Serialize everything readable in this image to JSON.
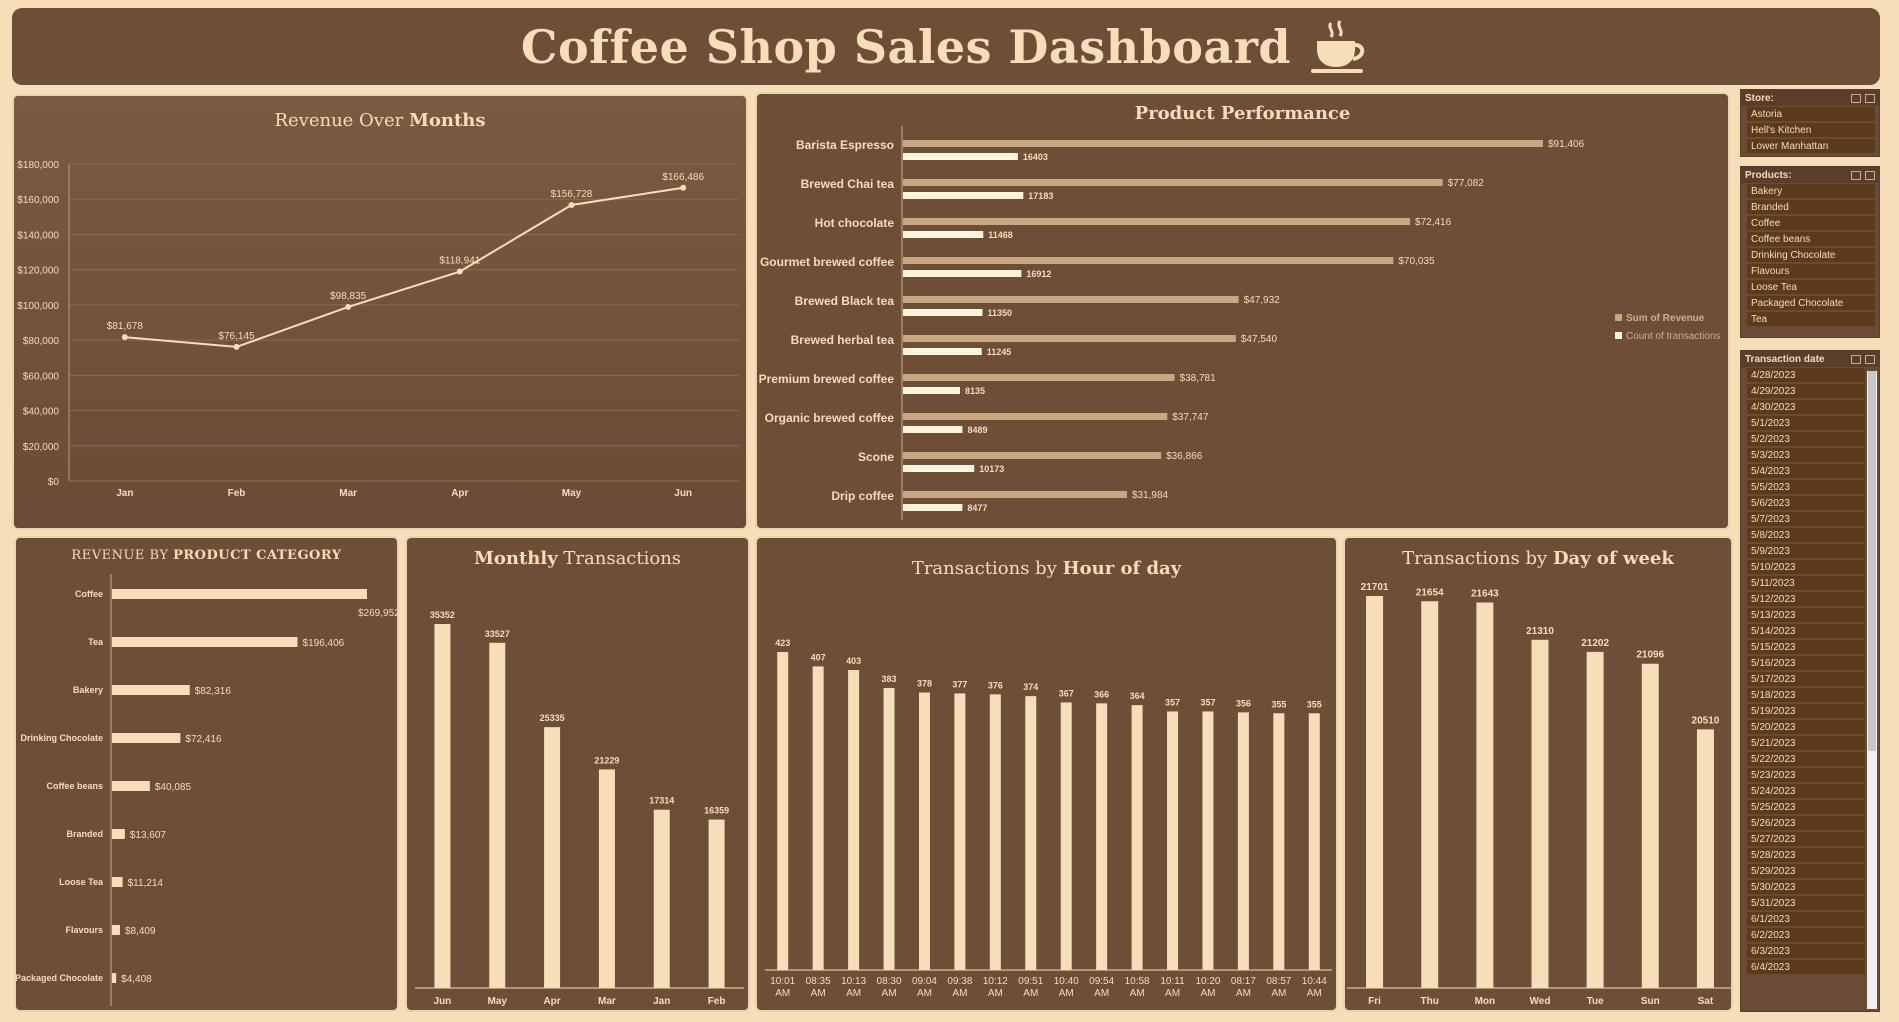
{
  "header": {
    "title": "Coffee Shop Sales Dashboard",
    "icon": "coffee-cup-icon"
  },
  "colors": {
    "background": "#f5deb8",
    "panel": "#6f4e37",
    "accent": "#f5deb8",
    "revenue_bar": "#c8a880",
    "count_bar": "#fff5dc"
  },
  "panels": {
    "revenue_months": {
      "title_a": "Revenue Over ",
      "title_b": "Months"
    },
    "product_performance": {
      "title": "Product Performance"
    },
    "revenue_category": {
      "title_a": "REVENUE BY ",
      "title_b": "PRODUCT CATEGORY"
    },
    "monthly_transactions": {
      "title_a": "Monthly",
      "title_b": " Transactions"
    },
    "hour_of_day": {
      "title_a": "Transactions by ",
      "title_b": "Hour of day"
    },
    "day_of_week": {
      "title_a": "Transactions by ",
      "title_b": "Day of week"
    }
  },
  "chart_data": [
    {
      "id": "revenue_months",
      "type": "line",
      "categories": [
        "Jan",
        "Feb",
        "Mar",
        "Apr",
        "May",
        "Jun"
      ],
      "values": [
        81678,
        76145,
        98835,
        118941,
        156728,
        166486
      ],
      "labels": [
        "$81,678",
        "$76,145",
        "$98,835",
        "$118,941",
        "$156,728",
        "$166,486"
      ],
      "ylim": [
        0,
        180000
      ],
      "yticks": [
        "$0",
        "$20,000",
        "$40,000",
        "$60,000",
        "$80,000",
        "$100,000",
        "$120,000",
        "$140,000",
        "$160,000",
        "$180,000"
      ],
      "grid": true
    },
    {
      "id": "product_performance",
      "type": "bar",
      "categories": [
        "Barista Espresso",
        "Brewed Chai tea",
        "Hot chocolate",
        "Gourmet brewed coffee",
        "Brewed Black tea",
        "Brewed herbal tea",
        "Premium brewed coffee",
        "Organic brewed coffee",
        "Scone",
        "Drip coffee"
      ],
      "series": [
        {
          "name": "Sum of Revenue",
          "values": [
            91406,
            77082,
            72416,
            70035,
            47932,
            47540,
            38781,
            37747,
            36866,
            31984
          ],
          "labels": [
            "$91,406",
            "$77,082",
            "$72,416",
            "$70,035",
            "$47,932",
            "$47,540",
            "$38,781",
            "$37,747",
            "$36,866",
            "$31,984"
          ]
        },
        {
          "name": "Count of transactions",
          "values": [
            16403,
            17183,
            11468,
            16912,
            11350,
            11245,
            8135,
            8489,
            10173,
            8477
          ],
          "labels": [
            "16403",
            "17183",
            "11468",
            "16912",
            "11350",
            "11245",
            "8135",
            "8489",
            "10173",
            "8477"
          ]
        }
      ],
      "legend": "right"
    },
    {
      "id": "revenue_category",
      "type": "bar",
      "categories": [
        "Coffee",
        "Tea",
        "Bakery",
        "Drinking Chocolate",
        "Coffee beans",
        "Branded",
        "Loose Tea",
        "Flavours",
        "Packaged Chocolate"
      ],
      "values": [
        269952,
        196406,
        82316,
        72416,
        40085,
        13607,
        11214,
        8409,
        4408
      ],
      "labels": [
        "$269,952",
        "$196,406",
        "$82,316",
        "$72,416",
        "$40,085",
        "$13,607",
        "$11,214",
        "$8,409",
        "$4,408"
      ]
    },
    {
      "id": "monthly_transactions",
      "type": "bar",
      "categories": [
        "Jun",
        "May",
        "Apr",
        "Mar",
        "Jan",
        "Feb"
      ],
      "values": [
        35352,
        33527,
        25335,
        21229,
        17314,
        16359
      ],
      "labels": [
        "35352",
        "33527",
        "25335",
        "21229",
        "17314",
        "16359"
      ]
    },
    {
      "id": "hour_of_day",
      "type": "bar",
      "categories": [
        [
          "10:01",
          "AM"
        ],
        [
          "08:35",
          "AM"
        ],
        [
          "10:13",
          "AM"
        ],
        [
          "08:30",
          "AM"
        ],
        [
          "09:04",
          "AM"
        ],
        [
          "09:38",
          "AM"
        ],
        [
          "10:12",
          "AM"
        ],
        [
          "09:51",
          "AM"
        ],
        [
          "10:40",
          "AM"
        ],
        [
          "09:54",
          "AM"
        ],
        [
          "10:58",
          "AM"
        ],
        [
          "10:11",
          "AM"
        ],
        [
          "10:20",
          "AM"
        ],
        [
          "08:17",
          "AM"
        ],
        [
          "08:57",
          "AM"
        ],
        [
          "10:44",
          "AM"
        ]
      ],
      "values": [
        423,
        407,
        403,
        383,
        378,
        377,
        376,
        374,
        367,
        366,
        364,
        357,
        357,
        356,
        355,
        355
      ],
      "labels": [
        "423",
        "407",
        "403",
        "383",
        "378",
        "377",
        "376",
        "374",
        "367",
        "366",
        "364",
        "357",
        "357",
        "356",
        "355",
        "355"
      ]
    },
    {
      "id": "day_of_week",
      "type": "bar",
      "categories": [
        "Fri",
        "Thu",
        "Mon",
        "Wed",
        "Tue",
        "Sun",
        "Sat"
      ],
      "values": [
        21701,
        21654,
        21643,
        21310,
        21202,
        21096,
        20510
      ],
      "labels": [
        "21701",
        "21654",
        "21643",
        "21310",
        "21202",
        "21096",
        "20510"
      ]
    }
  ],
  "slicers": {
    "store": {
      "title": "Store:",
      "items": [
        "Astoria",
        "Hell's Kitchen",
        "Lower Manhattan"
      ]
    },
    "products": {
      "title": "Products:",
      "items": [
        "Bakery",
        "Branded",
        "Coffee",
        "Coffee beans",
        "Drinking Chocolate",
        "Flavours",
        "Loose Tea",
        "Packaged Chocolate",
        "Tea"
      ]
    },
    "transaction_date": {
      "title": "Transaction date",
      "items": [
        "4/28/2023",
        "4/29/2023",
        "4/30/2023",
        "5/1/2023",
        "5/2/2023",
        "5/3/2023",
        "5/4/2023",
        "5/5/2023",
        "5/6/2023",
        "5/7/2023",
        "5/8/2023",
        "5/9/2023",
        "5/10/2023",
        "5/11/2023",
        "5/12/2023",
        "5/13/2023",
        "5/14/2023",
        "5/15/2023",
        "5/16/2023",
        "5/17/2023",
        "5/18/2023",
        "5/19/2023",
        "5/20/2023",
        "5/21/2023",
        "5/22/2023",
        "5/23/2023",
        "5/24/2023",
        "5/25/2023",
        "5/26/2023",
        "5/27/2023",
        "5/28/2023",
        "5/29/2023",
        "5/30/2023",
        "5/31/2023",
        "6/1/2023",
        "6/2/2023",
        "6/3/2023",
        "6/4/2023"
      ]
    }
  }
}
